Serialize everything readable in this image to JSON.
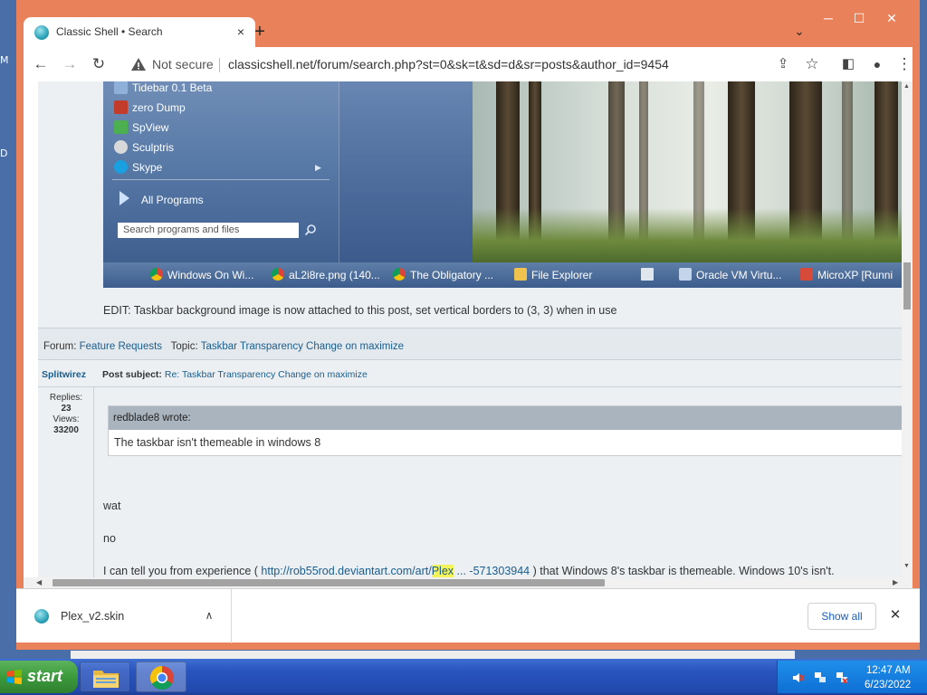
{
  "desktop": {
    "edge_top": "M",
    "edge_bottom": "D"
  },
  "browser": {
    "tab": {
      "title": "Classic Shell • Search",
      "close_glyph": "×"
    },
    "new_tab_glyph": "+",
    "tab_search_glyph": "⌄",
    "window_controls": {
      "minimize": "─",
      "maximize": "☐",
      "close": "✕"
    },
    "toolbar": {
      "back": "←",
      "forward": "→",
      "reload": "↻"
    },
    "omnibox": {
      "security_label": "Not secure",
      "url": "classicshell.net/forum/search.php?st=0&sk=t&sd=d&sr=posts&author_id=9454"
    },
    "toolbar_right": {
      "share": "⇪",
      "bookmark": "☆",
      "sidepanel": "◧",
      "profile": "●",
      "menu": "⋮"
    }
  },
  "post_image": {
    "start_menu": {
      "items": [
        {
          "label": "Tidebar 0.1 Beta",
          "icon": "tidebar-icon",
          "color": "#8fb0d8"
        },
        {
          "label": "zero Dump",
          "icon": "zero-dump-icon",
          "color": "#c23b2b"
        },
        {
          "label": "SpView",
          "icon": "spview-icon",
          "color": "#4caf50"
        },
        {
          "label": "Sculptris",
          "icon": "sculptris-icon",
          "color": "#d9d9d9"
        },
        {
          "label": "Skype",
          "icon": "skype-icon",
          "color": "#1aa0e0"
        }
      ],
      "all_programs": "All Programs",
      "search_placeholder": "Search programs and files",
      "submenu_glyph": "▶"
    },
    "taskbar": {
      "items": [
        {
          "label": "Windows On Wi...",
          "icon": "chrome-icon"
        },
        {
          "label": "aL2i8re.png (140...",
          "icon": "chrome-icon"
        },
        {
          "label": "The Obligatory ...",
          "icon": "chrome-icon"
        },
        {
          "label": "File Explorer",
          "icon": "folder-icon"
        },
        {
          "label": "",
          "icon": "window-icon"
        },
        {
          "label": "Oracle VM Virtu...",
          "icon": "virtualbox-icon"
        },
        {
          "label": "MicroXP [Runni",
          "icon": "vm-window-icon"
        }
      ]
    }
  },
  "post": {
    "edit_note": "EDIT: Taskbar background image is now attached to this post, set vertical borders to (3, 3) when in use",
    "forum_label": "Forum:",
    "forum_link": "Feature Requests",
    "topic_label": "Topic:",
    "topic_link": "Taskbar Transparency Change on maximize",
    "author": "Splitwirez",
    "subject_label": "Post subject:",
    "subject_prefix": "Re:",
    "subject_link": "Taskbar Transparency Change on maximize",
    "replies_label": "Replies:",
    "replies_value": "23",
    "views_label": "Views:",
    "views_value": "33200",
    "quote_author": "redblade8 wrote:",
    "quote_text": "The taskbar isn't themeable in windows 8",
    "line1": "wat",
    "line2": "no",
    "line3_before": "I can tell you from experience (",
    "line3_link_a": "http://rob55rod.deviantart.com/art/",
    "line3_highlight": "Plex",
    "line3_link_b": "... -571303944",
    "line3_after": ") that Windows 8's taskbar is themeable. Windows 10's isn't."
  },
  "scrollbars": {
    "up": "▲",
    "down": "▼",
    "left": "◀",
    "right": "▶"
  },
  "download_bar": {
    "file_name": "Plex_v2.skin",
    "chevron": "∧",
    "show_all": "Show all",
    "close_glyph": "✕"
  },
  "xp_taskbar": {
    "start_label": "start",
    "clock_time": "12:47 AM",
    "clock_date": "6/23/2022",
    "tray_icons": [
      "volume-muted-icon",
      "network-icon",
      "network-error-icon"
    ]
  },
  "colors": {
    "chrome_frame": "#e9815a",
    "link": "#1a5d8c",
    "highlight": "#f4f35a",
    "xp_taskbar": "#2a56c0",
    "xp_start": "#3c9a3c"
  }
}
